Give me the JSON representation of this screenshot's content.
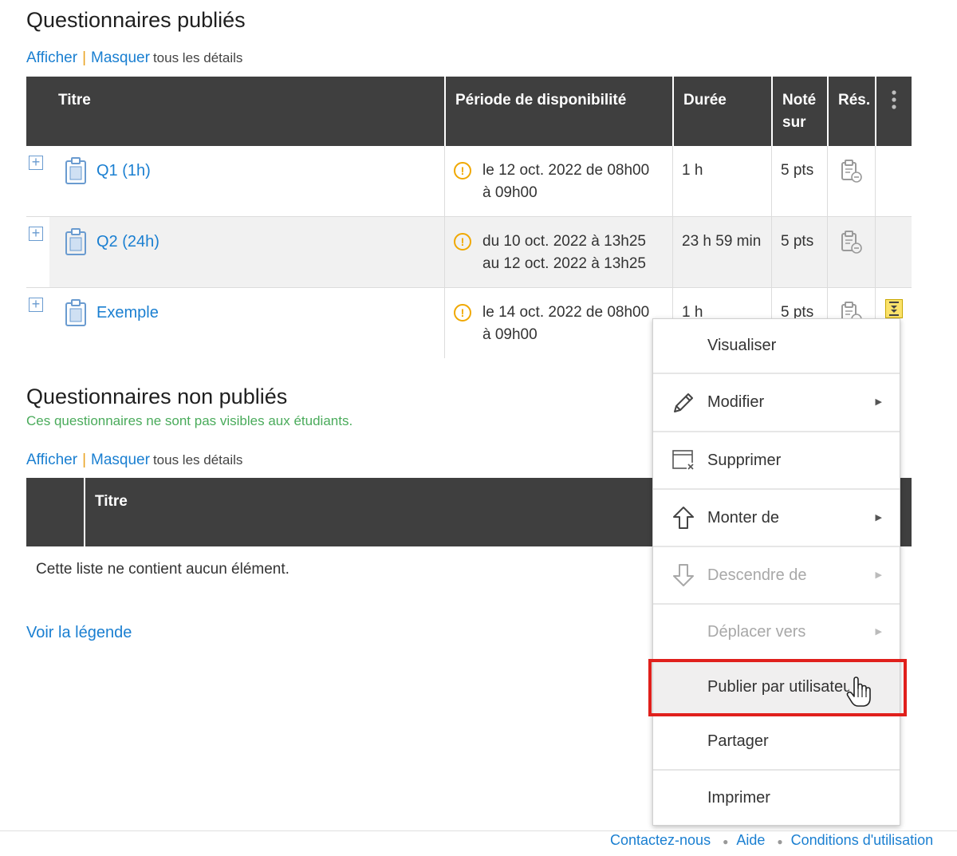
{
  "published": {
    "title": "Questionnaires publiés",
    "toggles": {
      "show": "Afficher",
      "hide": "Masquer",
      "rest": "tous les détails"
    },
    "columns": {
      "title": "Titre",
      "period": "Période de disponibilité",
      "duration": "Durée",
      "score_line1": "Noté",
      "score_line2": "sur",
      "results": "Rés."
    },
    "rows": [
      {
        "name": "Q1 (1h)",
        "period_line1": "le 12 oct. 2022 de 08h00",
        "period_line2": "à 09h00",
        "duration": "1 h",
        "score": "5 pts"
      },
      {
        "name": "Q2 (24h)",
        "period_line1": "du 10 oct. 2022 à 13h25",
        "period_line2": "au 12 oct. 2022 à 13h25",
        "duration": "23 h 59 min",
        "score": "5 pts"
      },
      {
        "name": "Exemple",
        "period_line1": "le 14 oct. 2022 de 08h00",
        "period_line2": "à 09h00",
        "duration": "1 h",
        "score": "5 pts"
      }
    ]
  },
  "unpublished": {
    "title": "Questionnaires non publiés",
    "note": "Ces questionnaires ne sont pas visibles aux étudiants.",
    "toggles": {
      "show": "Afficher",
      "hide": "Masquer",
      "rest": "tous les détails"
    },
    "columns": {
      "title": "Titre"
    },
    "empty": "Cette liste ne contient aucun élément."
  },
  "legend_link": "Voir la légende",
  "context_menu": {
    "items": [
      {
        "label": "Visualiser"
      },
      {
        "label": "Modifier"
      },
      {
        "label": "Supprimer"
      },
      {
        "label": "Monter de"
      },
      {
        "label": "Descendre de"
      },
      {
        "label": "Déplacer vers"
      },
      {
        "label": "Publier par utilisateur"
      },
      {
        "label": "Partager"
      },
      {
        "label": "Imprimer"
      }
    ],
    "highlight_color": "#e0201c"
  },
  "footer": {
    "contact": "Contactez-nous",
    "help": "Aide",
    "terms": "Conditions d'utilisation"
  },
  "colors": {
    "link": "#1a7fd1",
    "header_bg": "#3f3f3f",
    "note": "#4aab5b",
    "warning": "#f0a800"
  }
}
